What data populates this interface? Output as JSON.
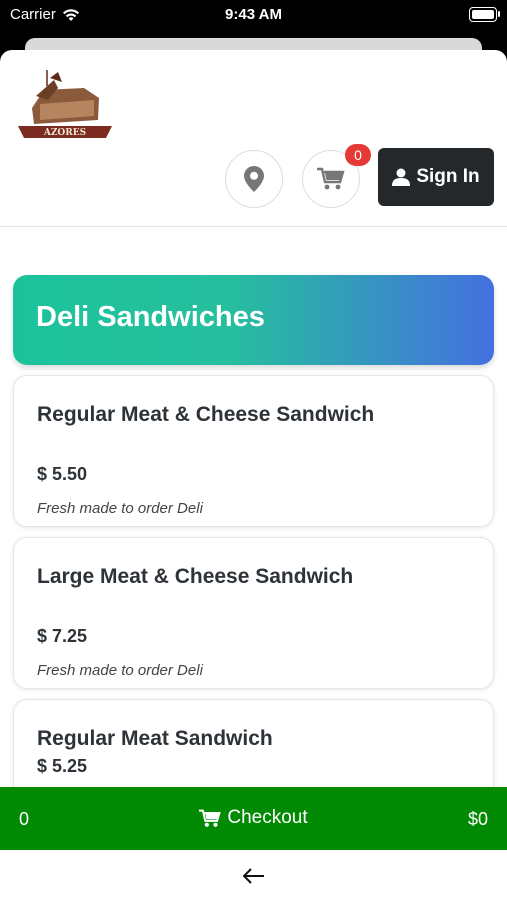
{
  "status": {
    "carrier": "Carrier",
    "time": "9:43 AM",
    "wifi_icon": "wifi-icon",
    "battery_icon": "battery-icon"
  },
  "header": {
    "logo_text": "AZORES",
    "location_icon": "location-pin-icon",
    "cart_icon": "cart-icon",
    "cart_count": "0",
    "signin_label": "Sign In",
    "user_icon": "user-icon"
  },
  "category": {
    "title": "Deli Sandwiches",
    "gradient_start": "#1cc39a",
    "gradient_end": "#4470e0"
  },
  "items": [
    {
      "name": "Regular Meat & Cheese Sandwich",
      "price": "$ 5.50",
      "description": "Fresh made to order Deli"
    },
    {
      "name": "Large Meat & Cheese Sandwich",
      "price": "$ 7.25",
      "description": "Fresh made to order Deli"
    },
    {
      "name": "Regular Meat Sandwich",
      "price": "$ 5.25",
      "description": ""
    }
  ],
  "checkout": {
    "count": "0",
    "label": "Checkout",
    "total": "$0",
    "cart_icon": "cart-icon",
    "bar_color": "#038a04"
  },
  "nav": {
    "back_icon": "back-arrow-icon"
  }
}
